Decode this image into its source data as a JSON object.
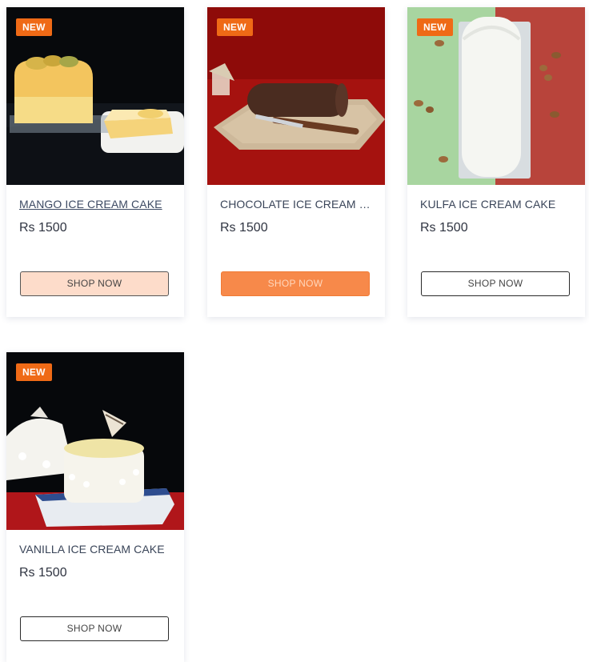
{
  "products": [
    {
      "badge": "NEW",
      "name": "MANGO ICE CREAM CAKE",
      "price": "Rs 1500",
      "button": "SHOP NOW"
    },
    {
      "badge": "NEW",
      "name": "CHOCOLATE ICE CREAM CAKE",
      "price": "Rs 1500",
      "button": "SHOP NOW"
    },
    {
      "badge": "NEW",
      "name": "KULFA ICE CREAM CAKE",
      "price": "Rs 1500",
      "button": "SHOP NOW"
    },
    {
      "badge": "NEW",
      "name": "VANILLA ICE CREAM CAKE",
      "price": "Rs 1500",
      "button": "SHOP NOW"
    }
  ],
  "colors": {
    "badge": "#ef6a16",
    "button_hover": "#f7894a",
    "button_pressed": "#fddcca"
  }
}
